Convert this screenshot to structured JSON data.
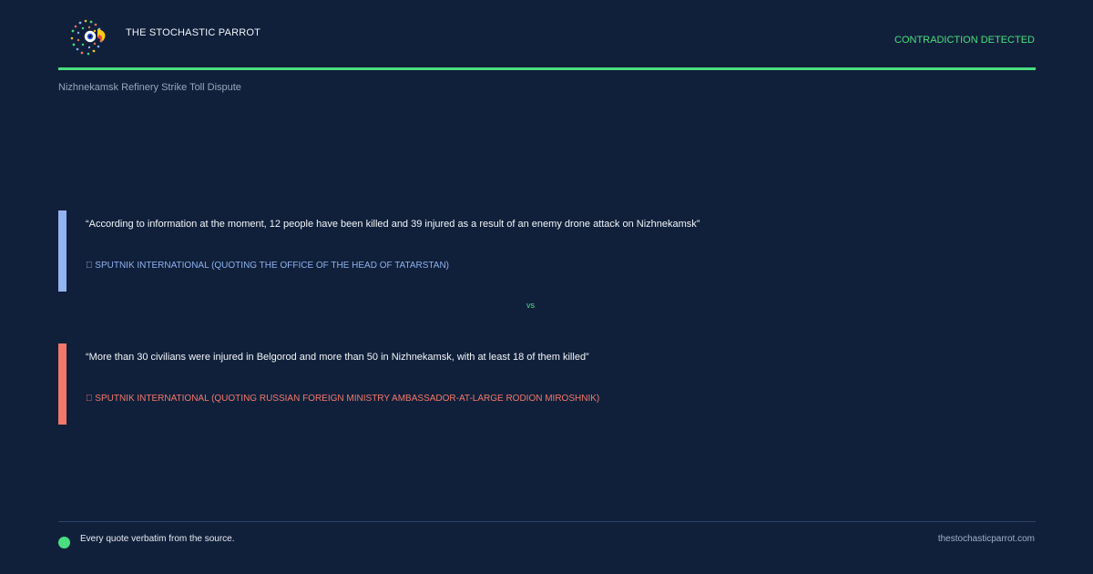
{
  "header": {
    "brand": "THE STOCHASTIC PARROT",
    "status": "CONTRADICTION DETECTED",
    "logo_icon": "parrot-logo-icon"
  },
  "topic": {
    "title": "Nizhnekamsk Refinery Strike Toll Dispute"
  },
  "claims": [
    {
      "quote": "“According to information at the moment, 12 people have been killed and 39 injured as a result of an enemy drone attack on Nizhnekamsk”",
      "source": "\u0000 SPUTNIK INTERNATIONAL (QUOTING THE OFFICE OF THE HEAD OF TATARSTAN)",
      "accent": "#93b4f0"
    },
    {
      "quote": "“More than 30 civilians were injured in Belgorod and more than 50 in Nizhnekamsk, with at least 18 of them killed”",
      "source": "\u0000 SPUTNIK INTERNATIONAL (QUOTING RUSSIAN FOREIGN MINISTRY AMBASSADOR-AT-LARGE RODION MIROSHNIK)",
      "accent": "#f2786b"
    }
  ],
  "vs_label": "vs",
  "footer": {
    "note": "Every quote verbatim from the source.",
    "url": "thestochasticparrot.com"
  },
  "colors": {
    "background": "#10203a",
    "accent_green": "#4ade80",
    "claim_a_blue": "#93b4f0",
    "claim_b_red": "#f2786b"
  }
}
